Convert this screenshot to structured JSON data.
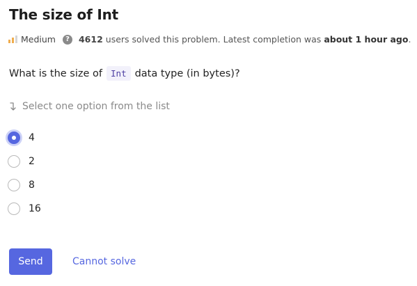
{
  "header": {
    "title": "The size of Int"
  },
  "meta": {
    "difficulty": "Medium",
    "help_glyph": "?",
    "solved_count": "4612",
    "solved_text": "users solved this problem. Latest completion was",
    "latest_time": "about 1 hour ago",
    "period": "."
  },
  "question": {
    "prefix": "What is the size of",
    "code": "Int",
    "suffix": "data type (in bytes)?"
  },
  "hint": {
    "text": "Select one option from the list"
  },
  "options": [
    {
      "label": "4",
      "selected": true
    },
    {
      "label": "2",
      "selected": false
    },
    {
      "label": "8",
      "selected": false
    },
    {
      "label": "16",
      "selected": false
    }
  ],
  "actions": {
    "send_label": "Send",
    "cannot_solve_label": "Cannot solve"
  },
  "colors": {
    "accent": "#5667e0",
    "difficulty_bar": "#f0ad4e"
  }
}
